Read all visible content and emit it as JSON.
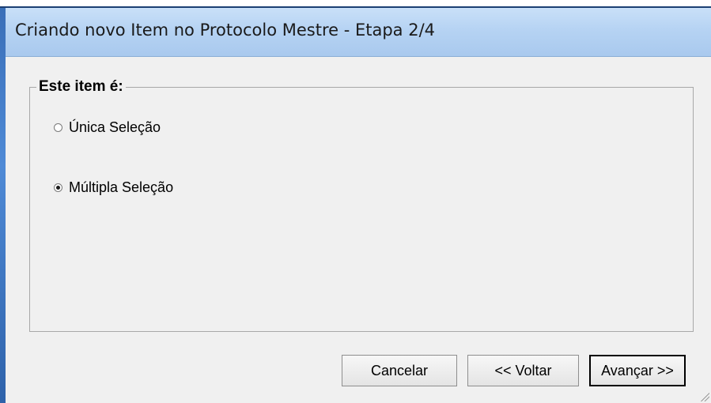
{
  "window": {
    "title": "Criando novo Item no Protocolo Mestre - Etapa 2/4"
  },
  "group": {
    "legend": "Este item é:",
    "options": [
      {
        "label": "Única Seleção",
        "checked": false
      },
      {
        "label": "Múltipla Seleção",
        "checked": true
      }
    ]
  },
  "buttons": {
    "cancel": "Cancelar",
    "back": "<< Voltar",
    "next": "Avançar >>"
  }
}
